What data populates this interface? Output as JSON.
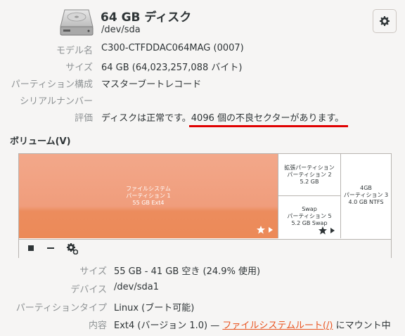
{
  "disk": {
    "title": "64 GB ディスク",
    "path": "/dev/sda"
  },
  "details": [
    {
      "label": "モデル名",
      "value": "C300-CTFDDAC064MAG (0007)"
    },
    {
      "label": "サイズ",
      "value": "64 GB (64,023,257,088 バイト)"
    },
    {
      "label": "パーティション構成",
      "value": "マスターブートレコード"
    },
    {
      "label": "シリアルナンバー",
      "value": ""
    },
    {
      "label": "評価",
      "value": "ディスクは正常です。4096 個の不良セクターがあります。"
    }
  ],
  "volumes": {
    "heading": "ボリューム(V)",
    "partition1": {
      "name": "ファイルシステム",
      "sub": "パーティション 1",
      "size": "55 GB Ext4"
    },
    "partition2": {
      "name": "拡張パーティション",
      "sub": "パーティション 2",
      "size": "5.2 GB"
    },
    "partition5": {
      "name": "Swap",
      "sub": "パーティション 5",
      "size": "5.2 GB Swap"
    },
    "partition3": {
      "name": "4GB",
      "sub": "パーティション 3",
      "size": "4.0 GB NTFS"
    }
  },
  "partition_info": [
    {
      "label": "サイズ",
      "value": "55 GB - 41 GB 空き (24.9% 使用)"
    },
    {
      "label": "デバイス",
      "value": "/dev/sda1"
    },
    {
      "label": "パーティションタイプ",
      "value": "Linux (ブート可能)"
    }
  ],
  "contents": {
    "label": "内容",
    "prefix": "Ext4 (バージョン 1.0) — ",
    "link": "ファイルシステムルート(/)",
    "suffix": " にマウント中"
  },
  "colors": {
    "partition_selected": "#f09d7c",
    "link": "#e95420",
    "highlight_underline": "#e00000"
  },
  "icons": [
    "hard-disk-icon",
    "gear-icon",
    "stop-icon",
    "minus-icon",
    "cog-icon",
    "star-icon",
    "play-icon"
  ]
}
